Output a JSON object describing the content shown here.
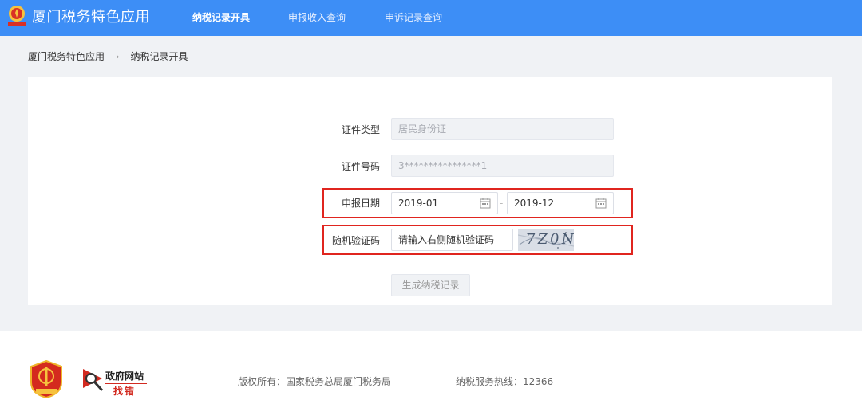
{
  "header": {
    "brand": "厦门税务特色应用",
    "nav": [
      {
        "label": "纳税记录开具",
        "active": true
      },
      {
        "label": "申报收入查询",
        "active": false
      },
      {
        "label": "申诉记录查询",
        "active": false
      }
    ],
    "emblem_icon": "tax-emblem-icon"
  },
  "breadcrumb": {
    "root": "厦门税务特色应用",
    "current": "纳税记录开具",
    "separator_icon": "chevron-right-icon"
  },
  "form": {
    "id_type": {
      "label": "证件类型",
      "value": "居民身份证"
    },
    "id_number": {
      "label": "证件号码",
      "value": "3****************1"
    },
    "report_date": {
      "label": "申报日期",
      "start": "2019-01",
      "end": "2019-12",
      "separator": "-",
      "icon": "calendar-icon"
    },
    "captcha": {
      "label": "随机验证码",
      "placeholder": "请输入右侧随机验证码",
      "image_text": "7Z0N"
    },
    "submit_label": "生成纳税记录"
  },
  "footer": {
    "gov_site": {
      "title": "政府网站",
      "subtitle": "找错"
    },
    "copyright": "版权所有：国家税务总局厦门税务局",
    "hotline": "纳税服务热线：12366"
  },
  "colors": {
    "header_bg": "#3d8ef6",
    "highlight": "#e0251f"
  }
}
